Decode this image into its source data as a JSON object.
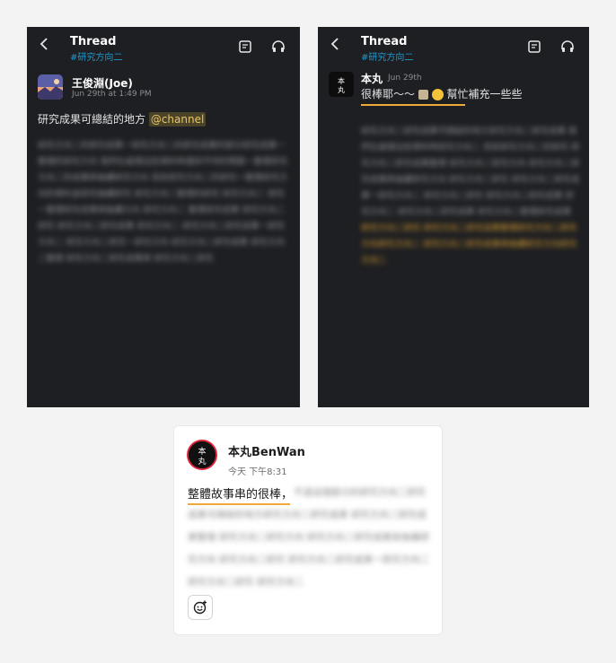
{
  "left_thread": {
    "title": "Thread",
    "channel": "#研究方向二",
    "author": "王俊淵(Joe)",
    "timestamp": "Jun 29th at 1:49 PM",
    "message_prefix": "研究成果可總結的地方 ",
    "mention": "@channel",
    "blurred_text": "研究方向二的研究成果一研究方向二的研究成果的部分研究成果一整理的研究方向 我們在處理這些資料時遇到不同的問題一整理研究方向二的成果與後續研究方向 目前研究方向二的研究一整理研究方向的資料並研究後續研究 研究方向二整理的研究 研究方向二 研究一整理研究成果與後續方向 研究方向二 整理研究成果 研究方向二 研究 研究方向二研究成果 研究方向二 研究方向二研究成果一研究方向二 研究方向二研究一研究方向 研究方向二研究成果 研究方向二整理 研究方向二研究成果與 研究方向二研究"
  },
  "right_thread": {
    "title": "Thread",
    "channel": "#研究方向二",
    "author": "本丸",
    "timestamp": "Jun 29th",
    "message_before": "很棒耶～～",
    "message_after": " 幫忙補充一些些",
    "avatar_text": "本\n丸",
    "blurred_text": "研究方向二研究成果可總結的地方研究方向二研究成果 我們在處理這些資料時研究方向二 目前研究方向二的研究 研究方向二研究成果整理 研究方向二研究方向 研究方向二研究成果與後續研究方向 研究方向二研究 研究方向二研究成果一研究方向二 研究方向二研究 研究方向二研究成果 研究方向二 研究方向二研究成果 研究方向二整理研究成果",
    "blurred_highlight_1": "研究方向二研究",
    "blurred_highlight_2": "研究方向二研究成果整理研究方向二研究方向研究方向二",
    "blurred_highlight_3": "研究方向二研究成果與後續研究方向研究方向二"
  },
  "card": {
    "author": "本丸BenWan",
    "timestamp": "今天 下午8:31",
    "message_visible": "整體故事串的很棒，",
    "blurred_text": "不過這個部分的研究方向二研究成果可總結的地方研究方向二研究成果 研究方向二研究成果整理 研究方向二研究方向 研究方向二研究成果與後續研究方向 研究方向二研究 研究方向二研究成果一研究方向二 研究方向二研究 研究方向二"
  },
  "icons": {
    "back": "chevron-left-icon",
    "note": "note-icon",
    "headphones": "headphones-icon",
    "emoji": "add-reaction-icon"
  },
  "colors": {
    "dark_bg": "#1e1f22",
    "channel_blue": "#1d9bd1",
    "mention_bg": "#4a4327",
    "highlight_orange": "#f0a93b",
    "avatar_red": "#e0263a"
  }
}
